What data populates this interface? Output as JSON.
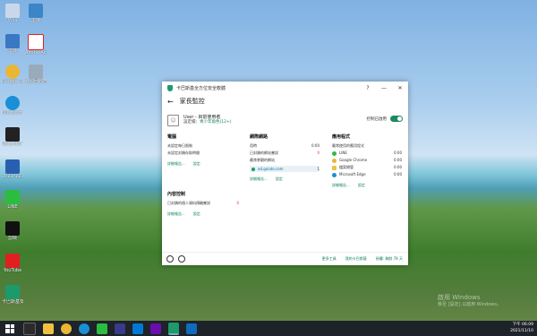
{
  "desktop": {
    "icons_col1": [
      {
        "label": "Viva",
        "color": "#c9d8e8"
      },
      {
        "label": "本機",
        "color": "#3b78c4"
      },
      {
        "label": "Google Chrome",
        "color": "#e9b636"
      },
      {
        "label": "Microsoft Edge",
        "color": "#1b8fd6"
      },
      {
        "label": "Recorder Video Edit",
        "color": "#222222"
      },
      {
        "label": "2021-1101",
        "color": "#2a5fb0"
      },
      {
        "label": "LINE",
        "color": "#2bbd3f"
      },
      {
        "label": "剪映",
        "color": "#111111"
      },
      {
        "label": "YouTube",
        "color": "#e02020"
      },
      {
        "label": "卡巴斯基安全",
        "color": "#1d9a6c"
      }
    ],
    "icons_col2": [
      {
        "label": "本機",
        "color": "#3a86c8"
      },
      {
        "label": "Adobe Acrobat",
        "color": "#d22"
      },
      {
        "label": "資源回收筒",
        "color": "#9ab"
      }
    ]
  },
  "window": {
    "title": "卡巴斯基全方位安全軟體",
    "help_btn": "?",
    "min_btn": "—",
    "max_btn": "☐",
    "close_btn": "✕",
    "back_icon": "←",
    "heading": "家長監控",
    "user": {
      "name": "User - 目前使用者",
      "role_prefix": "設定檔：",
      "role_link": "青少年角色(12+)"
    },
    "monitor_label": "控制已啟用",
    "computer": {
      "title": "電腦",
      "rows": [
        {
          "label": "未設定每日限制",
          "value": ""
        },
        {
          "label": "未設定封鎖存取時間",
          "value": ""
        }
      ],
      "report_link": "詳細報告...",
      "settings_link": "設定"
    },
    "content": {
      "title": "內容控制",
      "rows": [
        {
          "label": "已封鎖的個人資料傳輸嘗試",
          "value": "0"
        }
      ],
      "report_link": "詳細報告...",
      "settings_link": "設定"
    },
    "internet": {
      "title": "網際網路",
      "rows": [
        {
          "label": "用時",
          "value": "0:00"
        },
        {
          "label": "已封鎖的網站嘗試",
          "value": "0"
        }
      ],
      "sub": "最常參觀的網站",
      "site": {
        "name": "ad.goiato.com",
        "value": "1"
      },
      "report_link": "詳細報告...",
      "settings_link": "設定"
    },
    "apps": {
      "title": "應用程式",
      "sub": "最常使用的應用程式",
      "items": [
        {
          "name": "LINE",
          "value": "0:00",
          "color": "#2bbd3f"
        },
        {
          "name": "Google Chrome",
          "value": "0:00",
          "color": "#e9b636"
        },
        {
          "name": "檔案總管",
          "value": "0:00",
          "color": "#f0c040"
        },
        {
          "name": "Microsoft Edge",
          "value": "0:00",
          "color": "#1b8fd6"
        }
      ],
      "report_link": "詳細報告...",
      "settings_link": "設定"
    },
    "footer": {
      "more_tools": "更多工具",
      "my_kaspersky": "我的卡巴斯基",
      "license": "授權: 剩餘 78 天"
    }
  },
  "watermark": {
    "line1": "啟用 Windows",
    "line2": "移至 [設定] 以啟用 Windows。"
  },
  "taskbar": {
    "apps": [
      "#2b2b2b",
      "#f0c040",
      "#e9b636",
      "#1b8fd6",
      "#2bbd3f",
      "#3a3a8a",
      "#0078d4",
      "#6a0dad",
      "#1d9a6c",
      "#0f6cbd"
    ],
    "time": "下午 06:09",
    "date": "2021/11/10"
  }
}
